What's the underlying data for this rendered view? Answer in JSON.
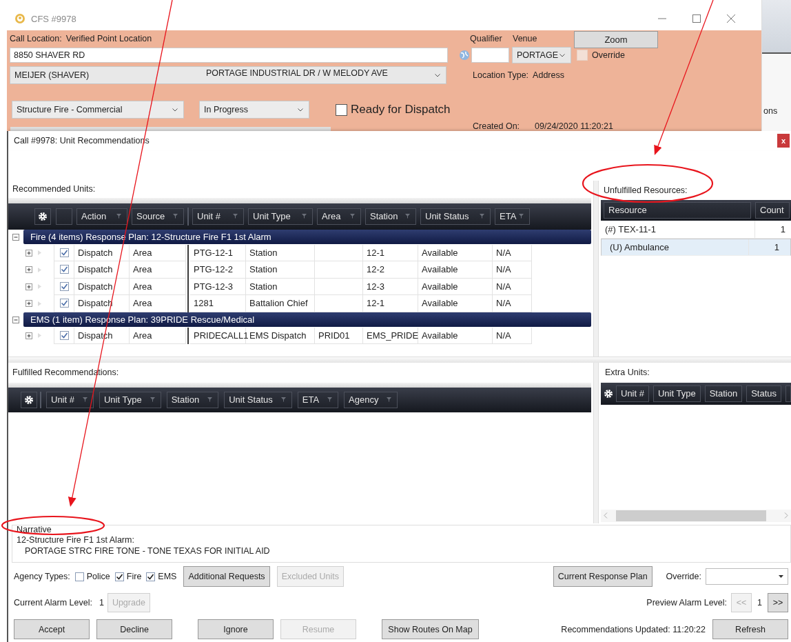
{
  "window": {
    "title": "CFS #9978"
  },
  "call_form": {
    "location_label": "Call Location:",
    "location_value": "Verified Point Location",
    "qualifier_label": "Qualifier",
    "venue_label": "Venue",
    "zoom_button": "Zoom",
    "address": "8850 SHAVER RD",
    "venue": "PORTAGE",
    "override": {
      "label": "Override",
      "checked": false
    },
    "place": "MEIJER (SHAVER)",
    "cross_streets": "PORTAGE INDUSTRIAL DR / W MELODY AVE",
    "location_type_label": "Location Type:",
    "location_type": "Address",
    "call_type": "Structure Fire - Commercial",
    "status": "In Progress",
    "ready": {
      "label": "Ready for Dispatch",
      "checked": false
    },
    "created_label": "Created On:",
    "created_value": "09/24/2020 11:20:21",
    "background_fragment": "ons"
  },
  "dialog": {
    "title": "Call #9978: Unit Recommendations",
    "close": "x"
  },
  "recommended": {
    "label": "Recommended Units:",
    "columns": [
      "Action",
      "Source",
      "Unit #",
      "Unit Type",
      "Area",
      "Station",
      "Unit Status",
      "ETA"
    ],
    "groups": [
      {
        "title": "Fire (4 items) Response Plan: 12-Structure Fire F1 1st Alarm",
        "expanded": true,
        "rows": [
          {
            "expanded": false,
            "checked": true,
            "cells": [
              "Dispatch",
              "Area",
              "PTG-12-1",
              "Station",
              "",
              "12-1",
              "Available",
              "N/A"
            ]
          },
          {
            "expanded": false,
            "checked": true,
            "cells": [
              "Dispatch",
              "Area",
              "PTG-12-2",
              "Station",
              "",
              "12-2",
              "Available",
              "N/A"
            ]
          },
          {
            "expanded": false,
            "checked": true,
            "cells": [
              "Dispatch",
              "Area",
              "PTG-12-3",
              "Station",
              "",
              "12-3",
              "Available",
              "N/A"
            ]
          },
          {
            "expanded": false,
            "checked": true,
            "cells": [
              "Dispatch",
              "Area",
              "1281",
              "Battalion Chief",
              "",
              "12-1",
              "Available",
              "N/A"
            ]
          }
        ]
      },
      {
        "title": "EMS (1 item) Response Plan: 39PRIDE Rescue/Medical",
        "expanded": true,
        "rows": [
          {
            "expanded": false,
            "checked": true,
            "cells": [
              "Dispatch",
              "Area",
              "PRIDECALL1",
              "EMS Dispatch",
              "PRID01",
              "EMS_PRIDE",
              "Available",
              "N/A"
            ]
          }
        ]
      }
    ]
  },
  "unfulfilled": {
    "label": "Unfulfilled Resources:",
    "columns": [
      "Resource",
      "Count"
    ],
    "rows": [
      {
        "resource": "(#) TEX-11-1",
        "count": "1",
        "selected": false
      },
      {
        "resource": "(U) Ambulance",
        "count": "1",
        "selected": true
      }
    ]
  },
  "fulfilled": {
    "label": "Fulfilled Recommendations:",
    "columns": [
      "Unit #",
      "Unit Type",
      "Station",
      "Unit Status",
      "ETA",
      "Agency"
    ]
  },
  "extra_units": {
    "label": "Extra Units:",
    "columns": [
      "Unit #",
      "Unit Type",
      "Station",
      "Status"
    ]
  },
  "narrative": {
    "label": "Narrative",
    "lines": [
      "12-Structure Fire F1 1st Alarm:",
      "PORTAGE STRC FIRE TONE - TONE TEXAS FOR INITIAL AID"
    ]
  },
  "agency_types": {
    "label": "Agency Types:",
    "items": [
      {
        "label": "Police",
        "checked": false
      },
      {
        "label": "Fire",
        "checked": true
      },
      {
        "label": "EMS",
        "checked": true
      }
    ]
  },
  "request_buttons": [
    {
      "label": "Additional Requests",
      "disabled": false
    },
    {
      "label": "Excluded Units",
      "disabled": true
    }
  ],
  "response_plan_button": {
    "label": "Current Response Plan",
    "disabled": false
  },
  "override": {
    "label": "Override:"
  },
  "alarm": {
    "current_label": "Current Alarm Level:",
    "current_value": "1",
    "upgrade": {
      "label": "Upgrade",
      "disabled": true
    },
    "preview_label": "Preview Alarm Level:",
    "previous": {
      "label": "<<",
      "disabled": true
    },
    "preview_value": "1",
    "next": {
      "label": ">>",
      "disabled": false
    }
  },
  "action_groups": [
    [
      {
        "label": "Accept",
        "disabled": false
      },
      {
        "label": "Decline",
        "disabled": false
      }
    ],
    [
      {
        "label": "Ignore",
        "disabled": false
      },
      {
        "label": "Resume",
        "disabled": true
      }
    ],
    [
      {
        "label": "Show Routes On Map",
        "disabled": false
      }
    ]
  ],
  "updated": "Recommendations Updated: 11:20:22",
  "refresh_button": {
    "label": "Refresh",
    "disabled": false
  }
}
